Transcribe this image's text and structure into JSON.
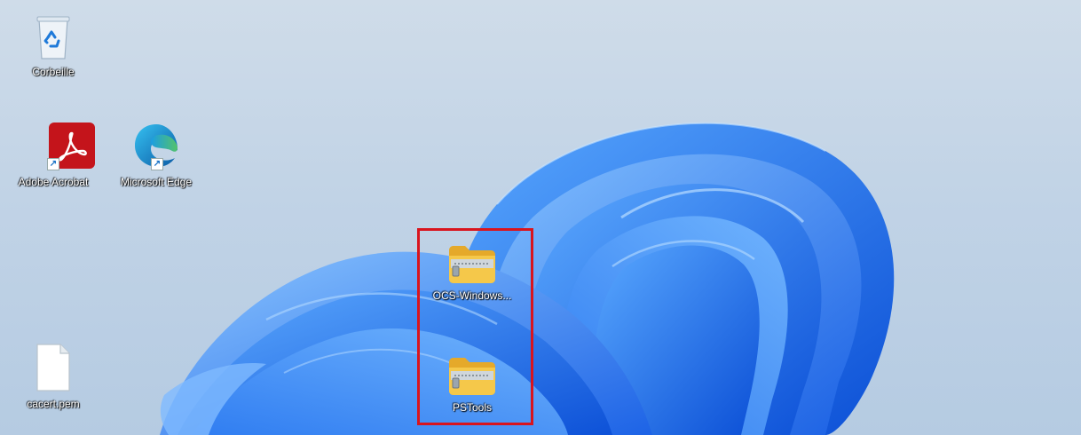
{
  "desktop": {
    "icons": [
      {
        "label": "Corbeille",
        "icon": "recycle-bin-icon"
      },
      {
        "label": "Adobe Acrobat",
        "icon": "adobe-acrobat-icon",
        "shortcut": true
      },
      {
        "label": "Microsoft Edge",
        "icon": "microsoft-edge-icon",
        "shortcut": true
      },
      {
        "label": "OCS-Windows...",
        "icon": "zip-folder-icon"
      },
      {
        "label": "PSTools",
        "icon": "zip-folder-icon"
      },
      {
        "label": "cacert.pem",
        "icon": "file-icon"
      }
    ]
  },
  "colors": {
    "highlight_border": "#d9141d",
    "acrobat_red": "#c4141b",
    "folder_yellow": "#f5c84a"
  }
}
